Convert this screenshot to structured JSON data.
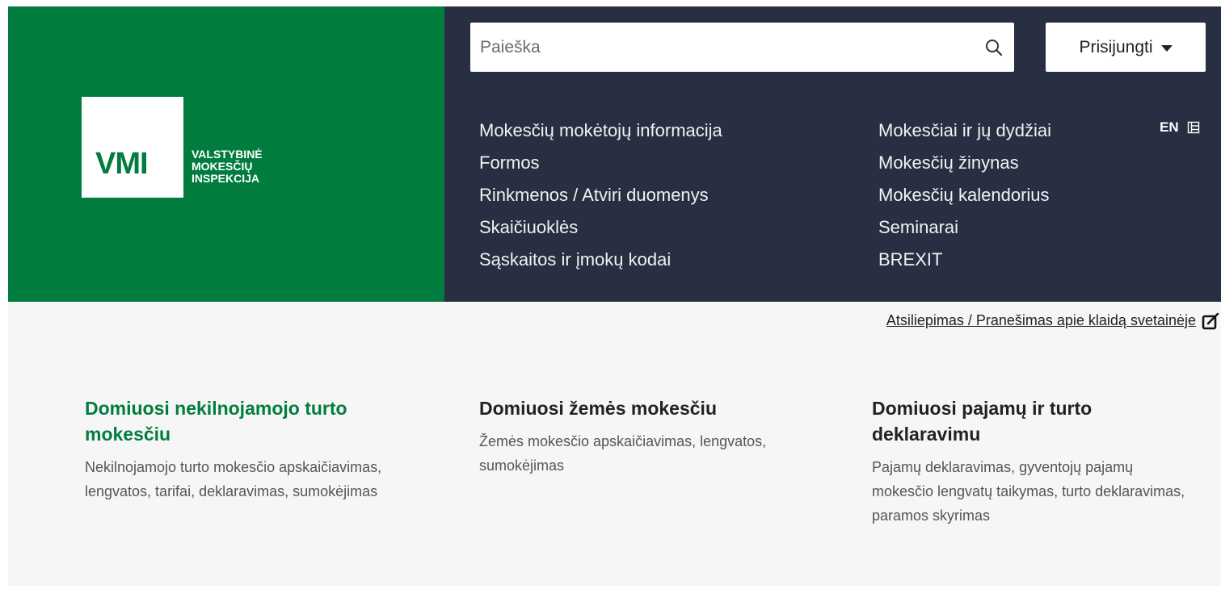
{
  "brand": {
    "logo_mark": "VMI",
    "name_lines": [
      "VALSTYBINĖ",
      "MOKESČIŲ",
      "INSPEKCIJA"
    ],
    "color": "#007d3e"
  },
  "search": {
    "placeholder": "Paieška",
    "value": "",
    "icon": "search-icon"
  },
  "login": {
    "label": "Prisijungti",
    "icon": "caret-down-icon"
  },
  "nav": {
    "column_1": [
      "Mokesčių mokėtojų informacija",
      "Formos",
      "Rinkmenos / Atviri duomenys",
      "Skaičiuoklės",
      "Sąskaitos ir įmokų kodai"
    ],
    "column_2": [
      "Mokesčiai ir jų dydžiai",
      "Mokesčių žinynas",
      "Mokesčių kalendorius",
      "Seminarai",
      "BREXIT"
    ],
    "background": "#292f42"
  },
  "language": {
    "label": "EN",
    "icon": "sitemap-icon"
  },
  "feedback": {
    "label": "Atsiliepimas / Pranešimas apie klaidą svetainėje",
    "icon": "edit-icon"
  },
  "cards": [
    {
      "title": "Domiuosi nekilnojamojo turto mokesčiu",
      "description": "Nekilnojamojo turto mokesčio apskaičiavimas, lengvatos, tarifai, deklaravimas, sumokėjimas"
    },
    {
      "title": "Domiuosi žemės mokesčiu",
      "description": "Žemės mokesčio apskaičiavimas, lengvatos, sumokėjimas"
    },
    {
      "title": "Domiuosi pajamų ir turto deklaravimu",
      "description": "Pajamų deklaravimas, gyventojų pajamų mokesčio lengvatų taikymas, turto deklaravimas, paramos skyrimas"
    }
  ]
}
